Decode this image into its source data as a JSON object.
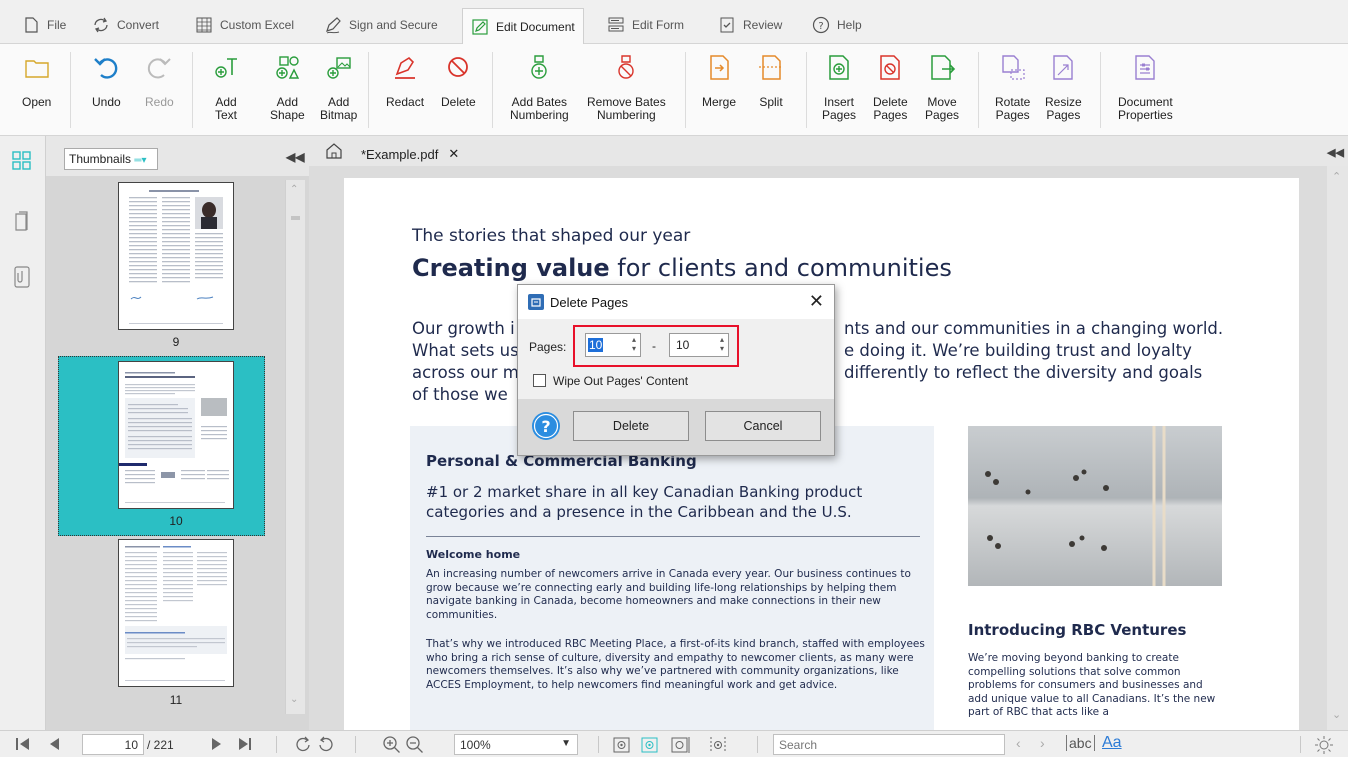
{
  "menu": {
    "tabs": [
      {
        "label": "File",
        "icon": "file-icon"
      },
      {
        "label": "Convert",
        "icon": "convert-icon"
      },
      {
        "label": "Custom Excel",
        "icon": "grid-icon"
      },
      {
        "label": "Sign and Secure",
        "icon": "pen-icon"
      },
      {
        "label": "Edit Document",
        "icon": "edit-icon",
        "active": true
      },
      {
        "label": "Edit Form",
        "icon": "form-icon"
      },
      {
        "label": "Review",
        "icon": "review-icon"
      },
      {
        "label": "Help",
        "icon": "help-icon"
      }
    ]
  },
  "ribbon": {
    "open": "Open",
    "undo": "Undo",
    "redo": "Redo",
    "add_text": [
      "Add",
      "Text"
    ],
    "add_shape": [
      "Add",
      "Shape"
    ],
    "add_bitmap": [
      "Add",
      "Bitmap"
    ],
    "redact": "Redact",
    "delete": "Delete",
    "add_bates": [
      "Add Bates",
      "Numbering"
    ],
    "remove_bates": [
      "Remove Bates",
      "Numbering"
    ],
    "merge": "Merge",
    "split": "Split",
    "insert_pages": [
      "Insert",
      "Pages"
    ],
    "delete_pages": [
      "Delete",
      "Pages"
    ],
    "move_pages": [
      "Move",
      "Pages"
    ],
    "rotate_pages": [
      "Rotate",
      "Pages"
    ],
    "resize_pages": [
      "Resize",
      "Pages"
    ],
    "document_properties": [
      "Document",
      "Properties"
    ]
  },
  "thumbnails": {
    "dropdown_label": "Thumbnails",
    "pages": [
      "9",
      "10",
      "11"
    ],
    "selected": "10"
  },
  "document": {
    "tab_title": "*Example.pdf",
    "kicker": "The stories that shaped our year",
    "title_bold": "Creating value",
    "title_rest": " for clients and communities",
    "body_l1a": "Our growth i",
    "body_l1b": "nts and our communities in a changing world.",
    "body_l2a": "What sets us",
    "body_l2b": "e doing it. We’re building trust and loyalty",
    "body_l3a": "across our m",
    "body_l3b": "differently to reflect the diversity and goals",
    "body_l4": "of those we",
    "pcb_title": "Personal & Commercial Banking",
    "pcb_subtitle": "#1 or 2 market share in all key Canadian Banking product categories and a presence in the Caribbean and the U.S.",
    "pcb_heading": "Welcome home",
    "pcb_p1": "An increasing number of newcomers arrive in Canada every year. Our business continues to grow because we’re connecting early and building life-long relationships by helping them navigate banking in Canada, become homeowners and make connections in their new communities.",
    "pcb_p2": "That’s why we introduced RBC Meeting Place, a first-of-its kind branch, staffed with employees who bring a rich sense of culture, diversity and empathy to newcomer clients, as many were newcomers themselves. It’s also why we’ve partnered with community organizations, like ACCES Employment, to help newcomers find meaningful work and get advice.",
    "ventures_title": "Introducing RBC Ventures",
    "ventures_p": "We’re moving beyond banking to create compelling solutions that solve common problems for consumers and businesses and add unique value to all Canadians. It’s the new part of RBC that acts like a"
  },
  "dialog": {
    "title": "Delete Pages",
    "pages_label": "Pages:",
    "from_value": "10",
    "dash": "-",
    "to_value": "10",
    "wipe_label": "Wipe Out Pages' Content",
    "wipe_checked": false,
    "delete_button": "Delete",
    "cancel_button": "Cancel",
    "highlight_color": "#e8102a"
  },
  "bottombar": {
    "page_current": "10",
    "page_total": "/ 221",
    "zoom": "100%",
    "search_placeholder": "Search",
    "match_case": "abc",
    "match_font": "Aa"
  },
  "colors": {
    "accent": "#2a9d3c",
    "selected_thumb": "#2bbfc4",
    "navy_text": "#1f2a4d"
  }
}
